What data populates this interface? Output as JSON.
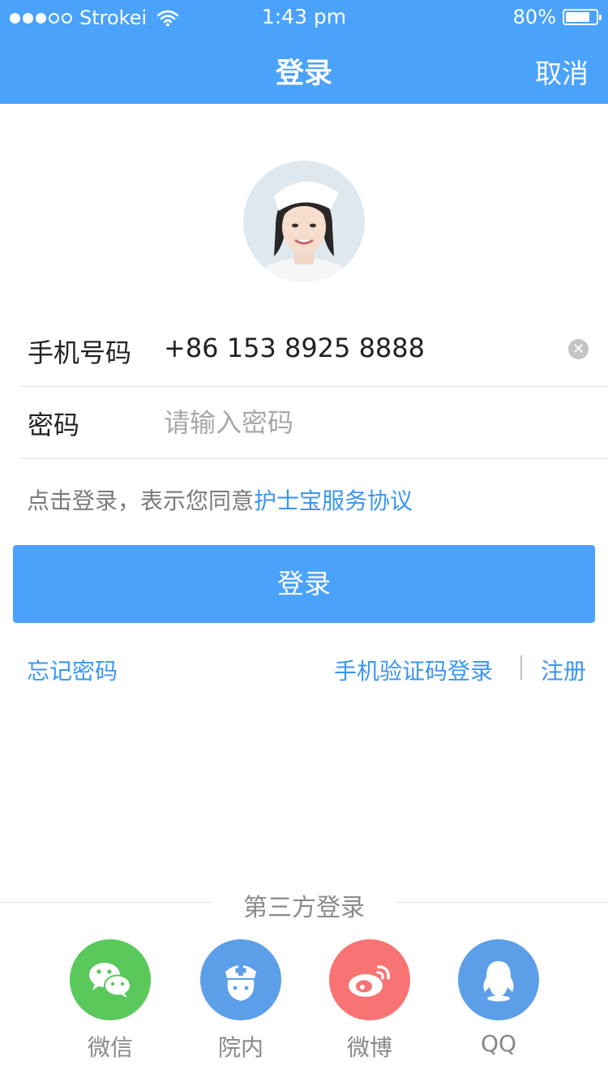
{
  "status_bar": {
    "signal_bars": 3,
    "signal_total": 5,
    "carrier": "Strokei",
    "time": "1:43 pm",
    "battery_text": "80%",
    "battery_level": 0.8
  },
  "nav": {
    "title": "登录",
    "cancel_label": "取消"
  },
  "form": {
    "phone": {
      "label": "手机号码",
      "value": "+86  153 8925 8888"
    },
    "password": {
      "label": "密码",
      "placeholder": "请输入密码"
    }
  },
  "agreement": {
    "prefix": "点击登录，表示您同意",
    "link": "护士宝服务协议"
  },
  "login_button": "登录",
  "links": {
    "forgot": "忘记密码",
    "sms_login": "手机验证码登录",
    "register": "注册"
  },
  "third_party": {
    "title": "第三方登录",
    "items": [
      {
        "label": "微信",
        "icon": "wechat-icon",
        "color": "#5ac85a"
      },
      {
        "label": "院内",
        "icon": "nurse-icon",
        "color": "#5c9fe8"
      },
      {
        "label": "微博",
        "icon": "weibo-icon",
        "color": "#f87373"
      },
      {
        "label": "QQ",
        "icon": "qq-icon",
        "color": "#5c9fe8"
      }
    ]
  },
  "colors": {
    "accent": "#4aa2fb",
    "link": "#3b96f2"
  }
}
